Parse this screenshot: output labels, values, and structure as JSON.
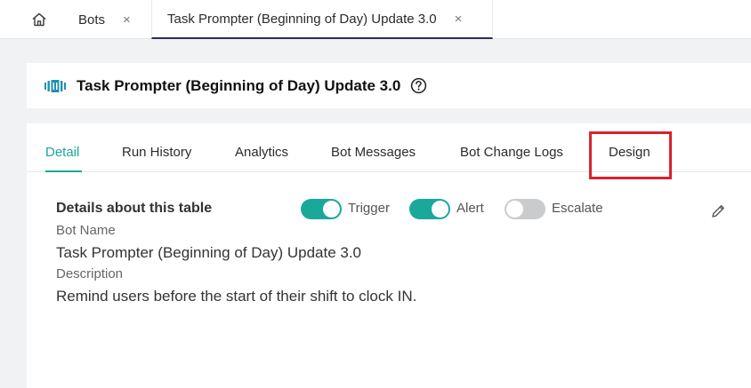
{
  "tabs": {
    "home_icon": "home-icon",
    "items": [
      {
        "label": "Bots",
        "close": "×"
      },
      {
        "label": "Task Prompter (Beginning of Day) Update 3.0",
        "close": "×"
      }
    ]
  },
  "header": {
    "icon": "bot-bars-icon",
    "title": "Task Prompter (Beginning of Day) Update 3.0",
    "help_icon": "help-circle-icon"
  },
  "subtabs": [
    {
      "label": "Detail",
      "active": true
    },
    {
      "label": "Run History"
    },
    {
      "label": "Analytics"
    },
    {
      "label": "Bot Messages"
    },
    {
      "label": "Bot Change Logs"
    },
    {
      "label": "Design",
      "highlighted": true
    }
  ],
  "details": {
    "title": "Details about this table",
    "toggles": [
      {
        "label": "Trigger",
        "on": true
      },
      {
        "label": "Alert",
        "on": true
      },
      {
        "label": "Escalate",
        "on": false
      }
    ],
    "bot_name_label": "Bot Name",
    "bot_name_value": "Task Prompter (Beginning of Day) Update 3.0",
    "description_label": "Description",
    "description_value": "Remind users before the start of their shift to clock IN."
  },
  "colors": {
    "accent": "#1aa89a",
    "highlight": "#d9232c",
    "active_tab_underline": "#2c2c54"
  }
}
